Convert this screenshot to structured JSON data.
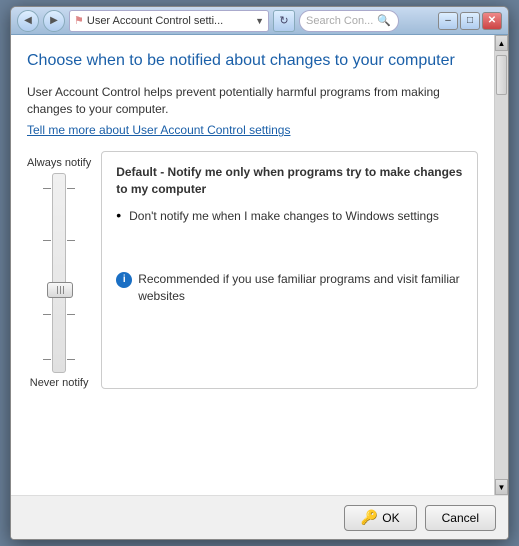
{
  "window": {
    "title": "User Account Control setti...",
    "controls": {
      "minimize": "–",
      "maximize": "□",
      "close": "✕"
    }
  },
  "nav": {
    "back_tooltip": "Back",
    "forward_tooltip": "Forward",
    "address_icon": "⚑",
    "address_text": "« User Account Control setti...",
    "dropdown": "▼",
    "refresh": "↻"
  },
  "search": {
    "placeholder": "Search Con...",
    "icon": "🔍"
  },
  "page": {
    "title": "Choose when to be notified about changes to your computer",
    "description": "User Account Control helps prevent potentially harmful programs from making changes to your computer.",
    "learn_more": "Tell me more about User Account Control settings",
    "slider": {
      "top_label": "Always notify",
      "bottom_label": "Never notify"
    },
    "info_panel": {
      "title": "Default - Notify me only when programs try to make changes to my computer",
      "bullet_text": "Don't notify me when I make changes to Windows settings",
      "note_text": "Recommended if you use familiar programs and visit familiar websites"
    }
  },
  "footer": {
    "ok_label": "OK",
    "cancel_label": "Cancel"
  }
}
